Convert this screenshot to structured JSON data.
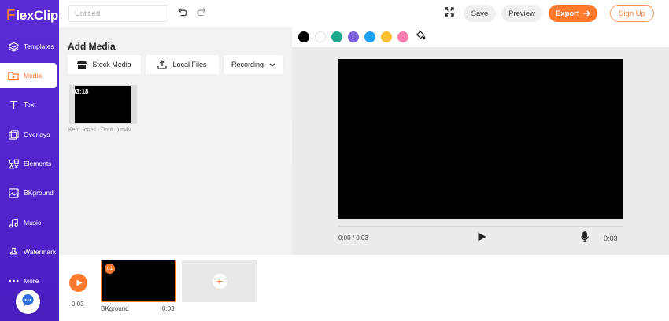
{
  "app": {
    "logo_prefix": "F",
    "logo_rest": "lexClip"
  },
  "sidebar": {
    "items": [
      {
        "label": "Templates",
        "icon": "layers-icon"
      },
      {
        "label": "Media",
        "icon": "media-folder-icon",
        "active": true
      },
      {
        "label": "Text",
        "icon": "text-icon"
      },
      {
        "label": "Overlays",
        "icon": "overlays-icon"
      },
      {
        "label": "Elements",
        "icon": "elements-icon"
      },
      {
        "label": "BKground",
        "icon": "background-icon"
      },
      {
        "label": "Music",
        "icon": "music-icon"
      },
      {
        "label": "Watermark",
        "icon": "watermark-icon"
      },
      {
        "label": "More",
        "icon": "more-dots-icon"
      }
    ]
  },
  "topbar": {
    "title_placeholder": "Untitled",
    "save_label": "Save",
    "preview_label": "Preview",
    "export_label": "Export",
    "signup_label": "Sign Up"
  },
  "media_panel": {
    "title": "Add Media",
    "tabs": {
      "stock": "Stock Media",
      "local": "Local Files",
      "recording": "Recording"
    },
    "items": [
      {
        "duration": "03:18",
        "name": "Kent Jones - Dont...).m4v"
      }
    ]
  },
  "colors": {
    "accent": "#ff7a2f",
    "sidebar": "#5b2bd6",
    "swatches": [
      "#000000",
      "#ffffff",
      "#1aab8b",
      "#7b5fdc",
      "#1e9ff2",
      "#fbc02d",
      "#f77fb0"
    ]
  },
  "preview": {
    "time_current": "0:00 / 0:03",
    "time_end": "0:03"
  },
  "timeline": {
    "time": "0:03",
    "clips": [
      {
        "index": "01",
        "name": "BKground",
        "duration": "0:03"
      }
    ],
    "add_symbol": "+"
  }
}
